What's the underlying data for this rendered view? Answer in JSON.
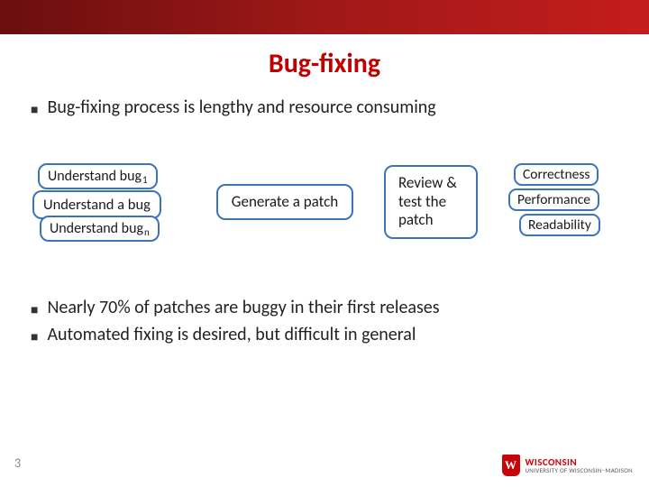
{
  "title": "Bug-fixing",
  "bullets_top": [
    "Bug-fixing process is lengthy and resource consuming"
  ],
  "diagram": {
    "understand": {
      "item_prefix": "Understand bug",
      "sub_first": "1",
      "middle": "Understand a bug",
      "sub_last": "n"
    },
    "generate": "Generate a patch",
    "review": "Review & test the patch",
    "criteria": [
      "Correctness",
      "Performance",
      "Readability"
    ]
  },
  "bullets_bottom": [
    "Nearly 70% of patches are buggy in their first releases",
    "Automated fixing is desired, but difficult in general"
  ],
  "page_number": "3",
  "logo": {
    "shield_letter": "W",
    "name": "WISCONSIN",
    "subtitle": "UNIVERSITY OF WISCONSIN–MADISON"
  }
}
